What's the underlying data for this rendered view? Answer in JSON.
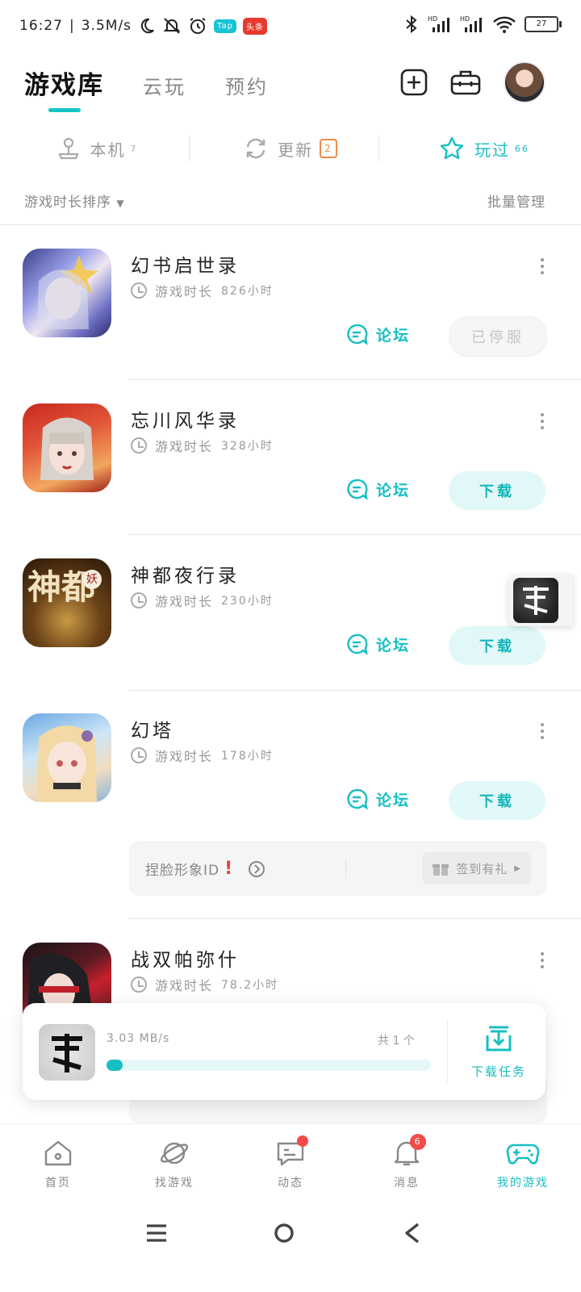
{
  "status_bar": {
    "time": "16:27",
    "speed": "3.5M/s",
    "badge_tap": "Tap",
    "badge_news": "头条",
    "battery": "27"
  },
  "header": {
    "tabs": [
      "游戏库",
      "云玩",
      "预约"
    ],
    "active_tab": "游戏库"
  },
  "filters": [
    {
      "label": "本机",
      "count": "7"
    },
    {
      "label": "更新",
      "count": "2"
    },
    {
      "label": "玩过",
      "count": "66"
    }
  ],
  "sort": {
    "label": "游戏时长排序",
    "manage": "批量管理"
  },
  "games": [
    {
      "name": "幻书启世录",
      "time_label": "游戏时长",
      "hours": "826小时",
      "forum": "论坛",
      "action": "已停服"
    },
    {
      "name": "忘川风华录",
      "time_label": "游戏时长",
      "hours": "328小时",
      "forum": "论坛",
      "action": "下载"
    },
    {
      "name": "神都夜行录",
      "time_label": "游戏时长",
      "hours": "230小时",
      "forum": "论坛",
      "action": "下载"
    },
    {
      "name": "幻塔",
      "time_label": "游戏时长",
      "hours": "178小时",
      "forum": "论坛",
      "action": "下载"
    },
    {
      "name": "战双帕弥什",
      "time_label": "游戏时长",
      "hours": "78.2小时",
      "forum": "",
      "action": ""
    }
  ],
  "tower_panel": {
    "text": "捏脸形象ID",
    "gift": "签到有礼"
  },
  "icon_texts": {
    "shendu_big": "神都",
    "shendu_small": "妖"
  },
  "download_card": {
    "speed": "3.03  MB/s",
    "count": "共  1  个",
    "task_label": "下载任务",
    "progress": 0.03
  },
  "nav": [
    {
      "label": "首页",
      "icon": "home-icon"
    },
    {
      "label": "找游戏",
      "icon": "planet-icon"
    },
    {
      "label": "动态",
      "icon": "chat-icon"
    },
    {
      "label": "消息",
      "icon": "bell-icon",
      "badge": "6"
    },
    {
      "label": "我的游戏",
      "icon": "gamepad-icon"
    }
  ],
  "colors": {
    "accent": "#17bfc2",
    "badge_orange": "#f08a4b",
    "notification_red": "#f14c48"
  }
}
